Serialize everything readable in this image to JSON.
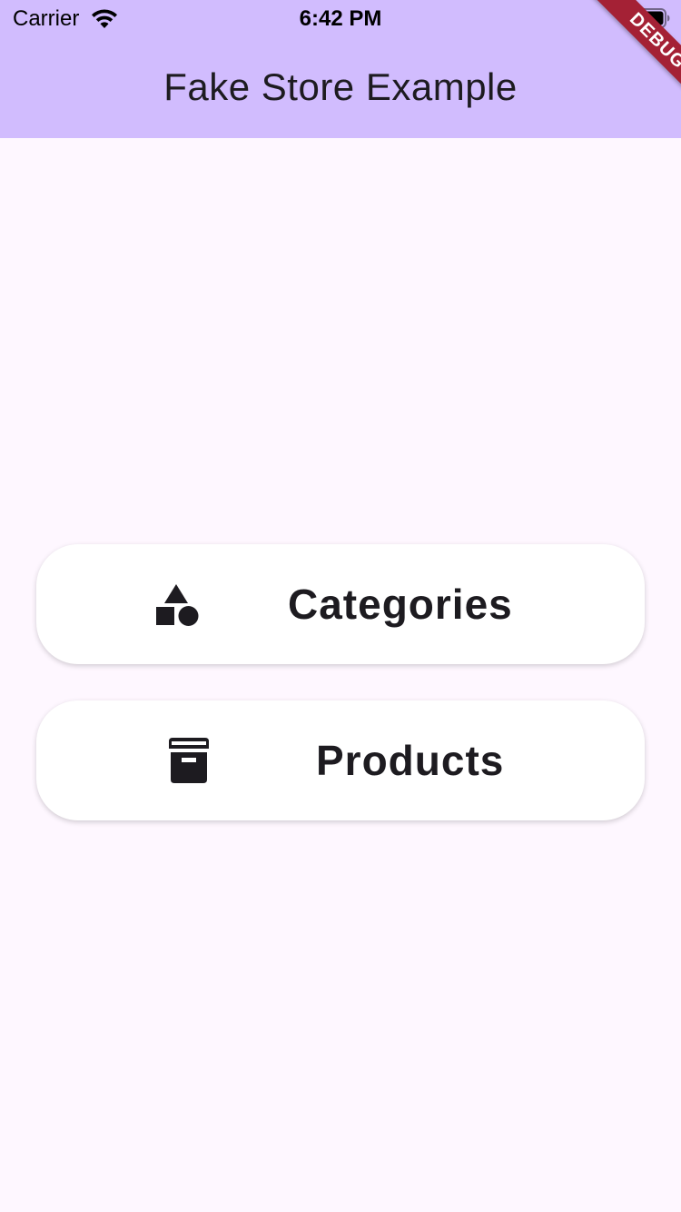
{
  "status_bar": {
    "carrier": "Carrier",
    "time": "6:42 PM",
    "wifi_icon": "wifi-icon",
    "battery_icon": "battery-icon"
  },
  "app_bar": {
    "title": "Fake Store Example",
    "background": "#d1bcfe"
  },
  "debug_banner": {
    "label": "DEBUG",
    "color": "#a42135"
  },
  "menu": {
    "categories": {
      "label": "Categories",
      "icon": "category-shapes-icon"
    },
    "products": {
      "label": "Products",
      "icon": "archive-box-icon"
    }
  },
  "colors": {
    "background": "#fef7ff",
    "text": "#1d1b20",
    "button_background": "#ffffff"
  }
}
